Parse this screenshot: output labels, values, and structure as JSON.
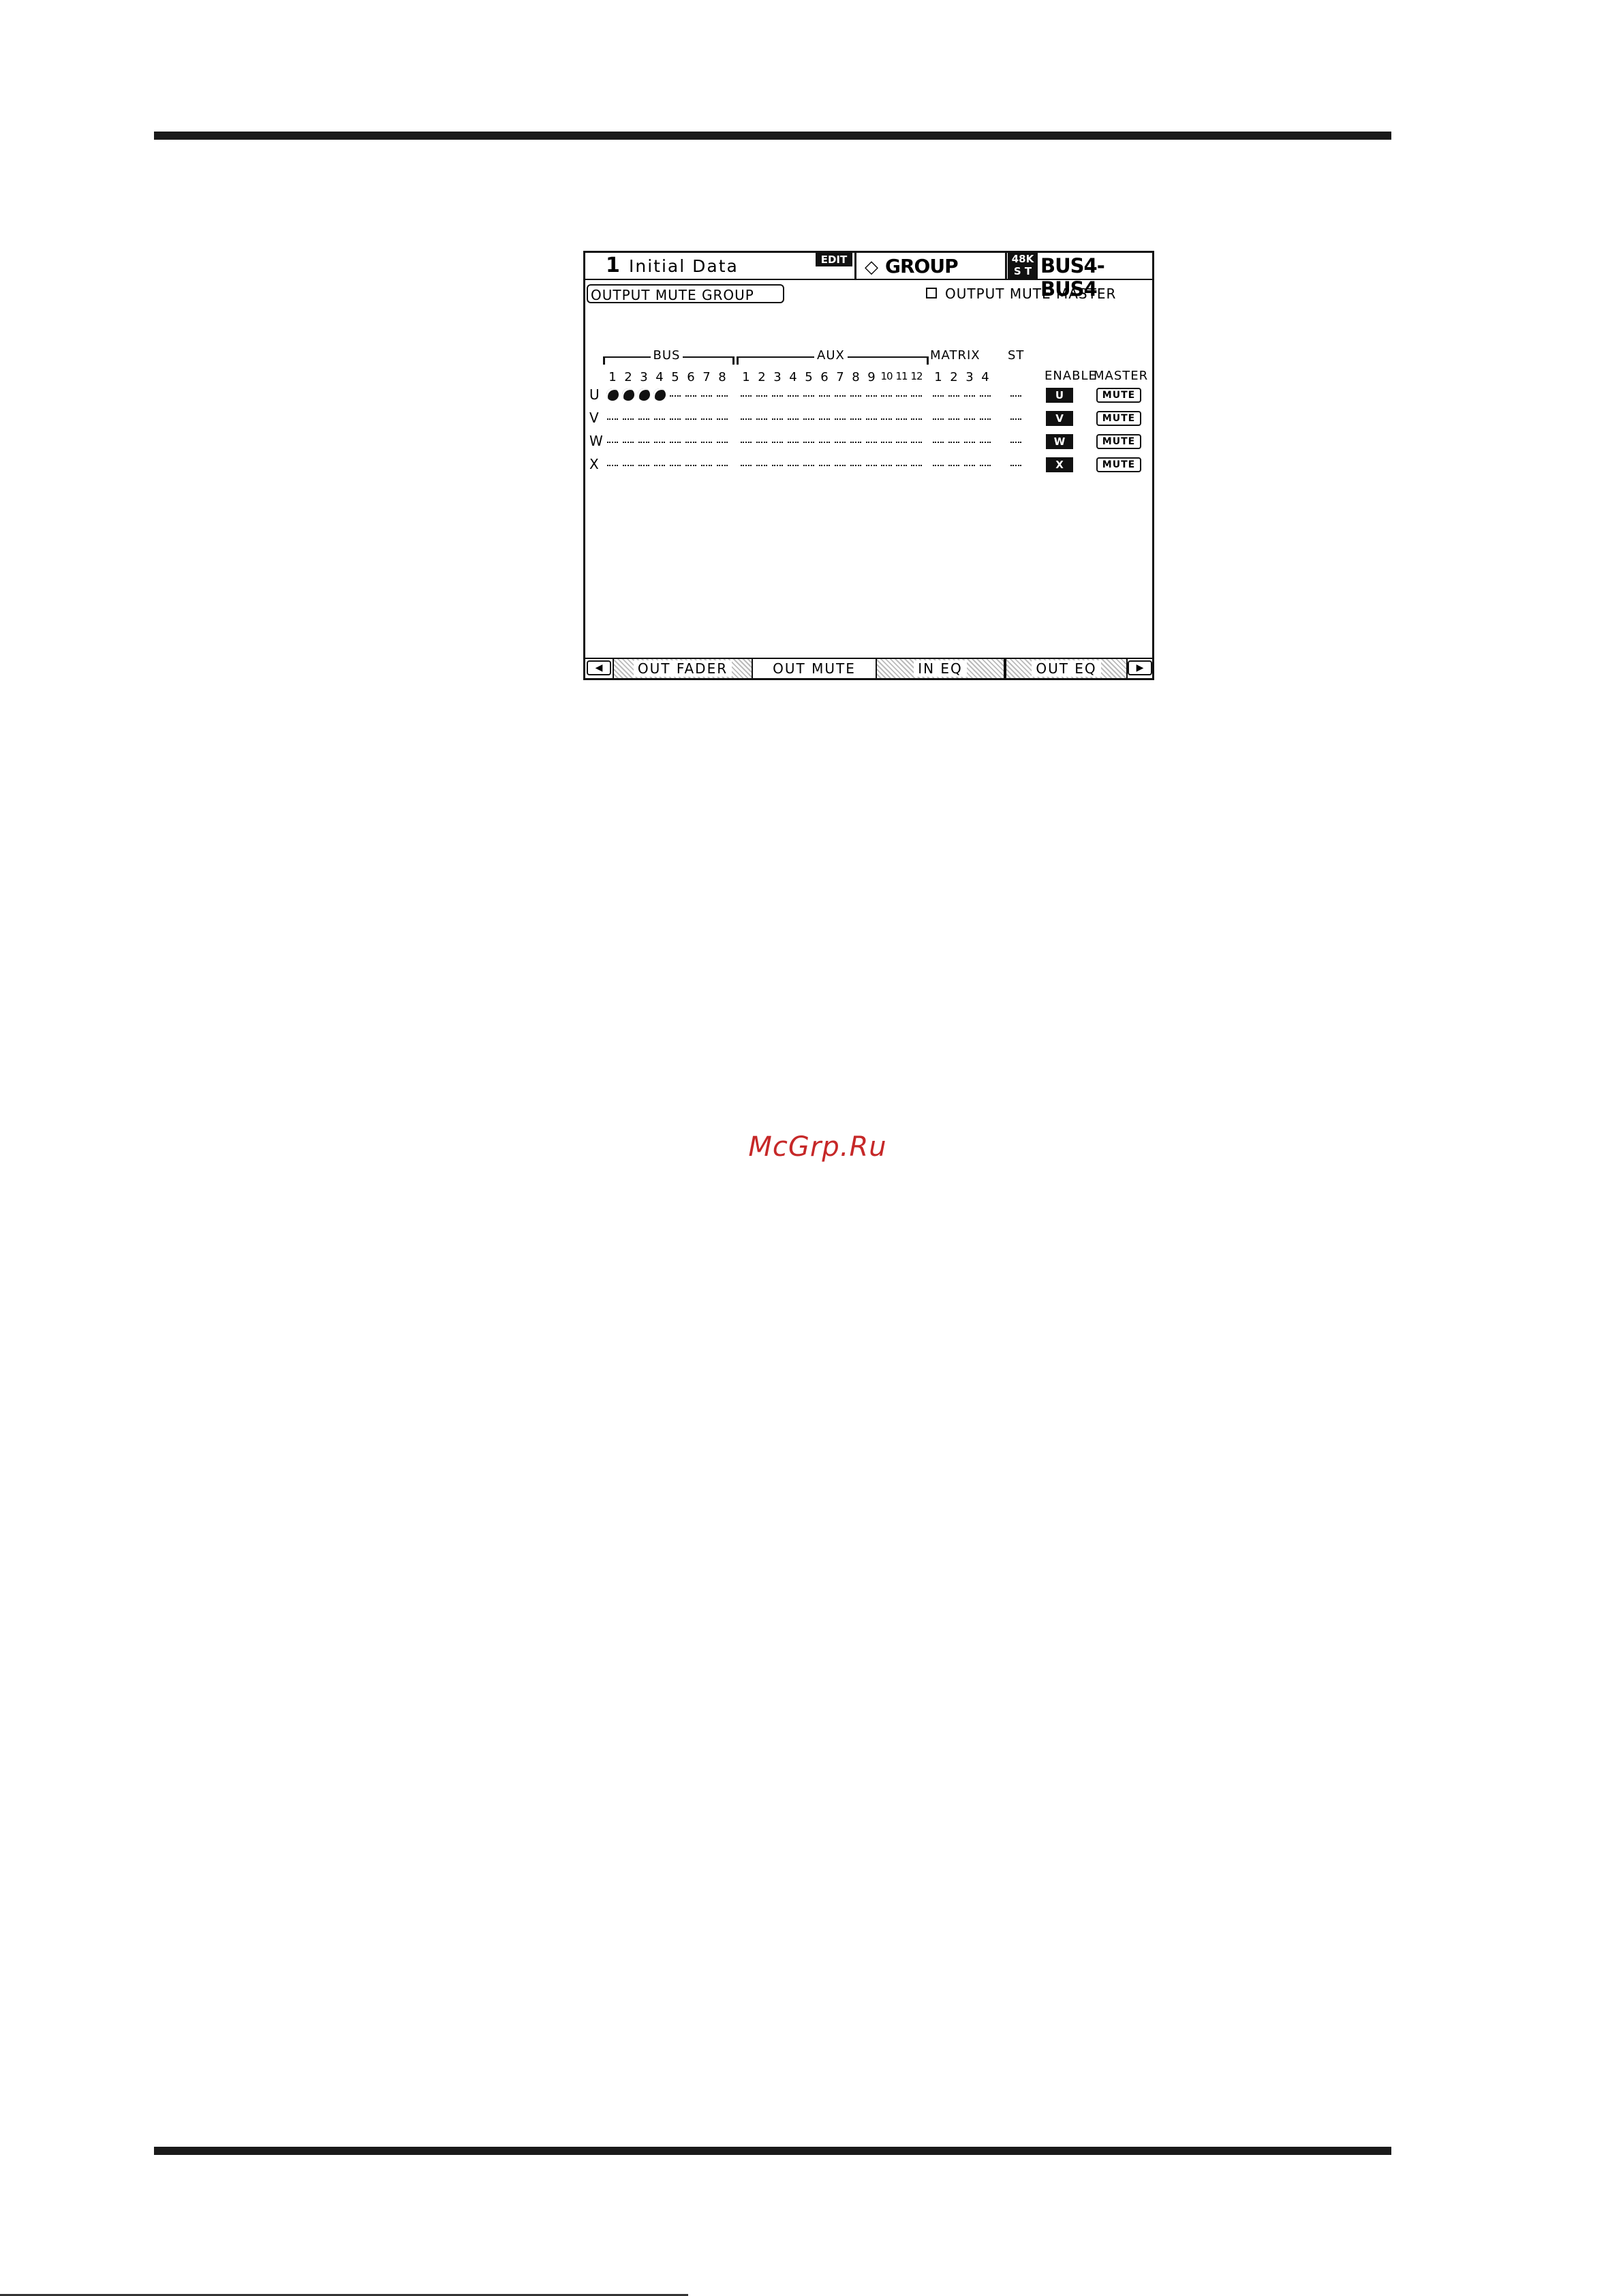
{
  "header": {
    "scene_number": "1",
    "scene_title": "Initial Data",
    "edit_badge": "EDIT",
    "page_name": "GROUP",
    "fs_top": "48K",
    "fs_bottom": "S T",
    "channel": "BUS4-BUS4"
  },
  "section": {
    "label": "OUTPUT MUTE GROUP",
    "master_label": "OUTPUT MUTE MASTER",
    "master_checked": false
  },
  "groups": {
    "bus": "BUS",
    "aux": "AUX",
    "matrix": "MATRIX",
    "st": "ST"
  },
  "columns": {
    "bus": [
      "1",
      "2",
      "3",
      "4",
      "5",
      "6",
      "7",
      "8"
    ],
    "aux": [
      "1",
      "2",
      "3",
      "4",
      "5",
      "6",
      "7",
      "8",
      "9",
      "10",
      "11",
      "12"
    ],
    "matrix": [
      "1",
      "2",
      "3",
      "4"
    ],
    "enable": "ENABLE",
    "master": "MASTER"
  },
  "rows": [
    {
      "label": "U",
      "bus_assigned": [
        1,
        2,
        3,
        4
      ],
      "enable": "U",
      "master": "MUTE"
    },
    {
      "label": "V",
      "bus_assigned": [],
      "enable": "V",
      "master": "MUTE"
    },
    {
      "label": "W",
      "bus_assigned": [],
      "enable": "W",
      "master": "MUTE"
    },
    {
      "label": "X",
      "bus_assigned": [],
      "enable": "X",
      "master": "MUTE"
    }
  ],
  "tabs": {
    "prev": "◀",
    "next": "▶",
    "items": [
      "OUT FADER",
      "OUT MUTE",
      "IN EQ",
      "OUT EQ"
    ],
    "active": 1
  },
  "watermark": "McGrp.Ru"
}
